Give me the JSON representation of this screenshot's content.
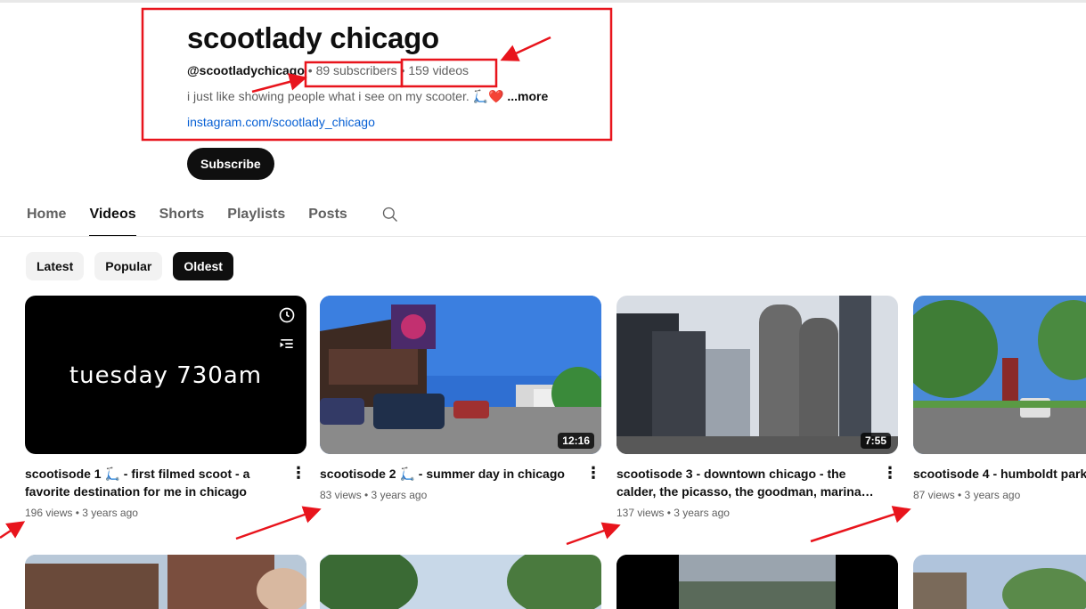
{
  "channel": {
    "name": "scootlady chicago",
    "handle": "@scootladychicago",
    "separator": "•",
    "subscribers": "89 subscribers",
    "videos_count": "159 videos",
    "description": "i just like showing people what i see on my scooter. 🛴❤️",
    "more_label": "...more",
    "link": "instagram.com/scootlady_chicago",
    "subscribe_label": "Subscribe"
  },
  "tabs": [
    {
      "label": "Home",
      "active": false
    },
    {
      "label": "Videos",
      "active": true
    },
    {
      "label": "Shorts",
      "active": false
    },
    {
      "label": "Playlists",
      "active": false
    },
    {
      "label": "Posts",
      "active": false
    }
  ],
  "chips": [
    {
      "label": "Latest",
      "active": false
    },
    {
      "label": "Popular",
      "active": false
    },
    {
      "label": "Oldest",
      "active": true
    }
  ],
  "videos": [
    {
      "title": "scootisode 1 🛴 - first filmed scoot - a favorite destination for me in chicago",
      "meta": "196 views • 3 years ago",
      "thumb_text": "tuesday 730am",
      "duration": ""
    },
    {
      "title": "scootisode 2 🛴 - summer day in chicago",
      "meta": "83 views • 3 years ago",
      "duration": "12:16"
    },
    {
      "title": "scootisode 3 - downtown chicago - the calder, the picasso, the goodman, marina…",
      "meta": "137 views • 3 years ago",
      "duration": "7:55"
    },
    {
      "title": "scootisode 4 - humboldt park",
      "meta": "87 views • 3 years ago",
      "duration": ""
    }
  ],
  "colors": {
    "accent_link": "#065fd4",
    "annotation_red": "#e8141c",
    "chip_bg": "#f2f2f2",
    "text_primary": "#0f0f0f",
    "text_secondary": "#606060"
  }
}
